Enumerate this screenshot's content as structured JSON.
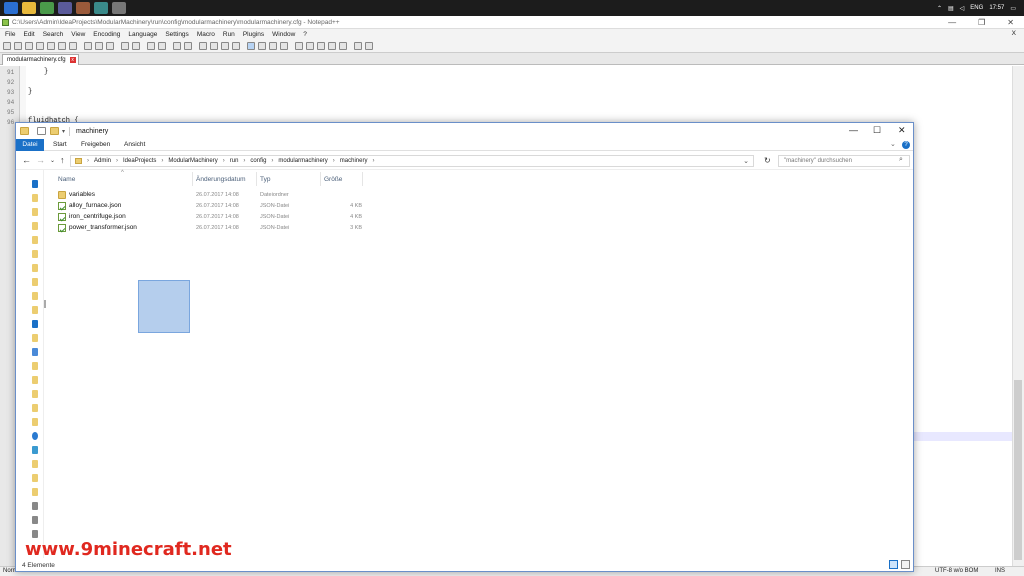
{
  "taskbar": {
    "lang": "ENG",
    "time": "17:57"
  },
  "notepad": {
    "title": "C:\\Users\\Admin\\IdeaProjects\\ModularMachinery\\run\\config\\modularmachinery\\modularmachinery.cfg - Notepad++",
    "window_controls": {
      "minimize": "—",
      "restore": "❐",
      "close": "✕"
    },
    "menu": [
      "File",
      "Edit",
      "Search",
      "View",
      "Encoding",
      "Language",
      "Settings",
      "Macro",
      "Run",
      "Plugins",
      "Window",
      "?"
    ],
    "menu_close": "X",
    "tab": {
      "label": "modularmachinery.cfg",
      "close": "x"
    },
    "line_numbers": [
      "91",
      "92",
      "93",
      "94",
      "95",
      "96"
    ],
    "code_lines": [
      {
        "line": "91",
        "text": "}"
      },
      {
        "line": "93",
        "text": "}"
      },
      {
        "line": "96",
        "text": "fluidhatch {"
      }
    ],
    "status": {
      "left": "Norm",
      "encoding": "UTF-8 w/o BOM",
      "mode": "INS"
    }
  },
  "explorer": {
    "title": "machinery",
    "window_controls": {
      "minimize": "—",
      "maximize": "☐",
      "close": "✕"
    },
    "ribbon_tabs": [
      {
        "label": "Datei",
        "active": true
      },
      {
        "label": "Start",
        "active": false
      },
      {
        "label": "Freigeben",
        "active": false
      },
      {
        "label": "Ansicht",
        "active": false
      }
    ],
    "ribbon_expand": "⌄",
    "help": "?",
    "nav": {
      "back": "←",
      "forward": "→",
      "recent": "⌄",
      "up": "↑"
    },
    "breadcrumb": [
      "Admin",
      "IdeaProjects",
      "ModularMachinery",
      "run",
      "config",
      "modularmachinery",
      "machinery"
    ],
    "breadcrumb_sep": "›",
    "address_dropdown": "⌄",
    "refresh": "↻",
    "search_placeholder": "\"machinery\" durchsuchen",
    "search_icon": "⌕",
    "columns": {
      "name": "Name",
      "date": "Änderungsdatum",
      "type": "Typ",
      "size": "Größe"
    },
    "sort_arrow": "^",
    "files": [
      {
        "name": "variables",
        "date": "26.07.2017 14:08",
        "type": "Dateiordner",
        "size": "",
        "icon": "folder-icon"
      },
      {
        "name": "alloy_furnace.json",
        "date": "26.07.2017 14:08",
        "type": "JSON-Datei",
        "size": "4 KB",
        "icon": "json-file-icon"
      },
      {
        "name": "iron_centrifuge.json",
        "date": "26.07.2017 14:08",
        "type": "JSON-Datei",
        "size": "4 KB",
        "icon": "json-file-icon"
      },
      {
        "name": "power_transformer.json",
        "date": "26.07.2017 14:08",
        "type": "JSON-Datei",
        "size": "3 KB",
        "icon": "json-file-icon"
      }
    ],
    "status_count": "4 Elemente"
  },
  "watermark": "www.9minecraft.net",
  "colors": {
    "accent": "#1a70c7",
    "folder": "#eccd70",
    "watermark": "#e0281f",
    "taskbar": "#1c1c1c"
  }
}
